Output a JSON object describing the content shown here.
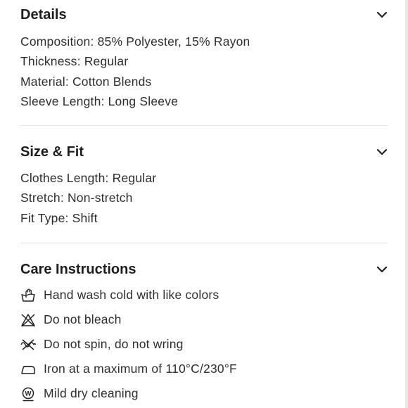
{
  "details": {
    "title": "Details",
    "lines": [
      "Composition: 85% Polyester, 15% Rayon",
      "Thickness: Regular",
      "Material: Cotton Blends",
      "Sleeve Length: Long Sleeve"
    ]
  },
  "size_fit": {
    "title": "Size & Fit",
    "lines": [
      "Clothes Length: Regular",
      "Stretch: Non-stretch",
      "Fit Type: Shift"
    ]
  },
  "care": {
    "title": "Care Instructions",
    "items": [
      {
        "icon": "hand-wash-icon",
        "text": "Hand wash cold with like colors"
      },
      {
        "icon": "no-bleach-icon",
        "text": "Do not bleach"
      },
      {
        "icon": "no-wring-icon",
        "text": "Do not spin, do not wring"
      },
      {
        "icon": "iron-icon",
        "text": "Iron at a maximum of 110°C/230°F"
      },
      {
        "icon": "mild-dry-clean-icon",
        "text": "Mild dry cleaning"
      }
    ]
  }
}
